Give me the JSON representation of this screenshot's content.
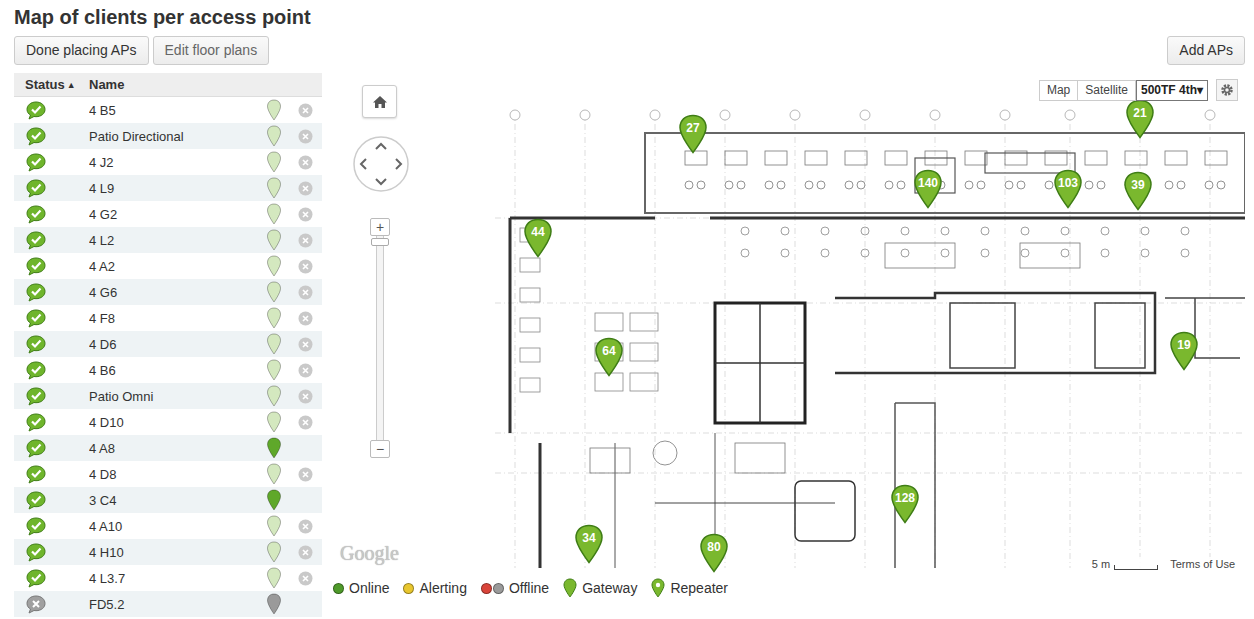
{
  "title": "Map of clients per access point",
  "toolbar": {
    "buttons": [
      "Done placing APs",
      "Edit floor plans"
    ],
    "add_button": "Add APs"
  },
  "table": {
    "columns": [
      {
        "label": "Status",
        "sort": "▲"
      },
      {
        "label": "Name"
      }
    ],
    "rows": [
      {
        "name": "4 B5",
        "online": true,
        "removable": true,
        "color": "#d4e8bf"
      },
      {
        "name": "Patio Directional",
        "online": true,
        "removable": true,
        "color": "#d4e8bf"
      },
      {
        "name": "4 J2",
        "online": true,
        "removable": true,
        "color": "#d4e8bf"
      },
      {
        "name": "4 L9",
        "online": true,
        "removable": true,
        "color": "#d4e8bf"
      },
      {
        "name": "4 G2",
        "online": true,
        "removable": true,
        "color": "#d4e8bf"
      },
      {
        "name": "4 L2",
        "online": true,
        "removable": true,
        "color": "#d4e8bf"
      },
      {
        "name": "4 A2",
        "online": true,
        "removable": true,
        "color": "#d4e8bf"
      },
      {
        "name": "4 G6",
        "online": true,
        "removable": true,
        "color": "#d4e8bf"
      },
      {
        "name": "4 F8",
        "online": true,
        "removable": true,
        "color": "#d4e8bf"
      },
      {
        "name": "4 D6",
        "online": true,
        "removable": true,
        "color": "#d4e8bf"
      },
      {
        "name": "4 B6",
        "online": true,
        "removable": true,
        "color": "#d4e8bf"
      },
      {
        "name": "Patio Omni",
        "online": true,
        "removable": true,
        "color": "#d4e8bf"
      },
      {
        "name": "4 D10",
        "online": true,
        "removable": true,
        "color": "#d4e8bf"
      },
      {
        "name": "4 A8",
        "online": true,
        "removable": false,
        "color": "#5fa82a"
      },
      {
        "name": "4 D8",
        "online": true,
        "removable": true,
        "color": "#d4e8bf"
      },
      {
        "name": "3 C4",
        "online": true,
        "removable": false,
        "color": "#5fa82a"
      },
      {
        "name": "4 A10",
        "online": true,
        "removable": true,
        "color": "#d4e8bf"
      },
      {
        "name": "4 H10",
        "online": true,
        "removable": true,
        "color": "#d4e8bf"
      },
      {
        "name": "4 L3.7",
        "online": true,
        "removable": true,
        "color": "#d4e8bf"
      },
      {
        "name": "FD5.2",
        "online": false,
        "removable": false,
        "color": "#9a9a9a"
      }
    ]
  },
  "map": {
    "zoom_in": "+",
    "zoom_out": "−",
    "view_buttons": [
      {
        "label": "Map",
        "selected": false
      },
      {
        "label": "Satellite",
        "selected": false
      }
    ],
    "floor": {
      "label": "500TF 4th",
      "arrow": "▾"
    },
    "watermark": "Google",
    "scale": "5 m",
    "terms": "Terms of Use",
    "pins": [
      {
        "label": "27"
      },
      {
        "label": "21"
      },
      {
        "label": "140"
      },
      {
        "label": "103"
      },
      {
        "label": "39"
      },
      {
        "label": "44"
      },
      {
        "label": "64"
      },
      {
        "label": "19"
      },
      {
        "label": "128"
      },
      {
        "label": "34"
      },
      {
        "label": "80"
      }
    ]
  },
  "legend": [
    {
      "label": "Online",
      "kind": "dot",
      "colors": [
        "#4f9a2a"
      ]
    },
    {
      "label": "Alerting",
      "kind": "dot",
      "colors": [
        "#e8c62e"
      ]
    },
    {
      "label": "Offline",
      "kind": "dot",
      "colors": [
        "#d9443a",
        "#9a9a9a"
      ]
    },
    {
      "label": "Gateway",
      "kind": "pin",
      "colors": [
        "#7ab82e"
      ]
    },
    {
      "label": "Repeater",
      "kind": "pin",
      "colors": [
        "#7ab82e"
      ]
    }
  ]
}
